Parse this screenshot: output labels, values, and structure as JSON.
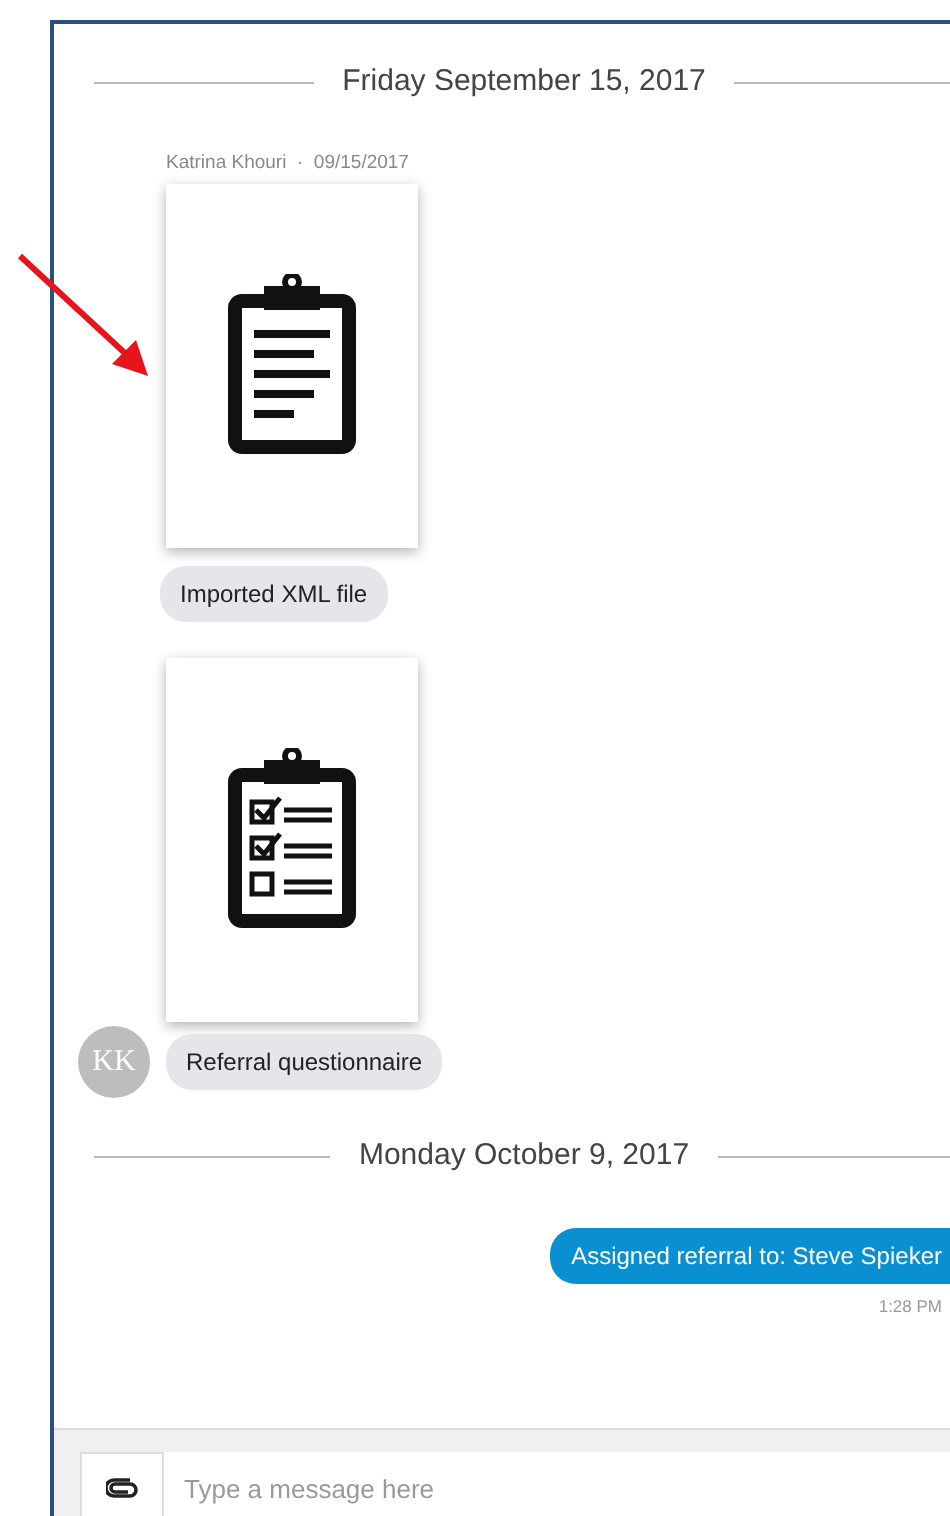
{
  "messages": [
    {
      "kind": "date_divider",
      "text": "Friday September 15, 2017"
    },
    {
      "kind": "sender",
      "name": "Katrina Khouri",
      "separator": "·",
      "date": "09/15/2017"
    },
    {
      "kind": "attachment"
    },
    {
      "kind": "bubble",
      "text": "Imported XML file"
    },
    {
      "kind": "attachment"
    },
    {
      "kind": "bubble",
      "text": "Referral questionnaire",
      "avatar": "KK"
    },
    {
      "kind": "date_divider",
      "text": "Monday October 9, 2017"
    },
    {
      "kind": "outgoing",
      "text": "Assigned referral to: Steve Spieker",
      "time": "1:28 PM"
    }
  ],
  "composer": {
    "placeholder": "Type a message here"
  }
}
